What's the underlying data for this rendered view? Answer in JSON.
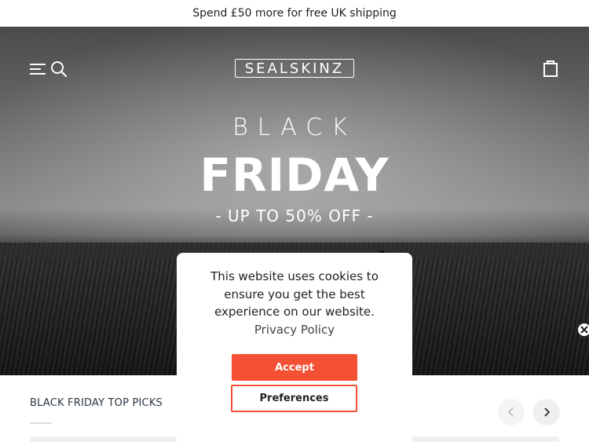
{
  "promo_bar": {
    "text": "Spend £50 more for free UK shipping"
  },
  "header": {
    "logo": "SEALSKINZ",
    "menu_icon": "menu-icon",
    "search_icon": "search-icon",
    "cart_icon": "shopping-bag-icon"
  },
  "hero": {
    "line1": "BLACK",
    "line2": "FRIDAY",
    "offer": "- UP TO 50% OFF -"
  },
  "cookie_banner": {
    "message": "This website uses cookies to ensure you get the best experience on our website.",
    "privacy_link": "Privacy Policy",
    "accept_label": "Accept",
    "preferences_label": "Preferences",
    "accent_color": "#f45134"
  },
  "popup_close_icon": "close-icon",
  "top_picks": {
    "title": "BLACK FRIDAY TOP PICKS",
    "prev_icon": "chevron-left-icon",
    "next_icon": "chevron-right-icon"
  }
}
